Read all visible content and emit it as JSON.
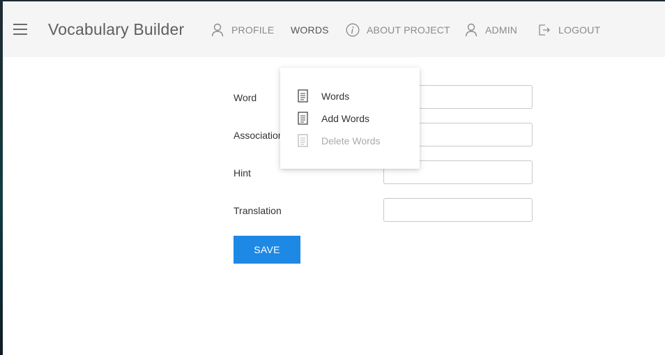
{
  "header": {
    "title": "Vocabulary Builder",
    "nav": [
      {
        "label": "PROFILE",
        "icon": "user-icon"
      },
      {
        "label": "WORDS",
        "icon": null,
        "active": true
      },
      {
        "label": "ABOUT PROJECT",
        "icon": "info-icon"
      },
      {
        "label": "ADMIN",
        "icon": "user-icon"
      },
      {
        "label": "LOGOUT",
        "icon": "logout-icon"
      }
    ]
  },
  "form": {
    "fields": [
      {
        "label": "Word",
        "value": ""
      },
      {
        "label": "Association",
        "value": ""
      },
      {
        "label": "Hint",
        "value": ""
      },
      {
        "label": "Translation",
        "value": ""
      }
    ],
    "save_label": "SAVE"
  },
  "words_menu": {
    "items": [
      {
        "label": "Words",
        "icon": "document-icon",
        "disabled": false
      },
      {
        "label": "Add Words",
        "icon": "document-icon",
        "disabled": false
      },
      {
        "label": "Delete Words",
        "icon": "document-icon",
        "disabled": true
      }
    ]
  },
  "colors": {
    "navbar_bg": "#f5f5f5",
    "accent": "#1e88e5",
    "nav_text": "#8a8a8a",
    "disabled_text": "#aaaaaa"
  }
}
